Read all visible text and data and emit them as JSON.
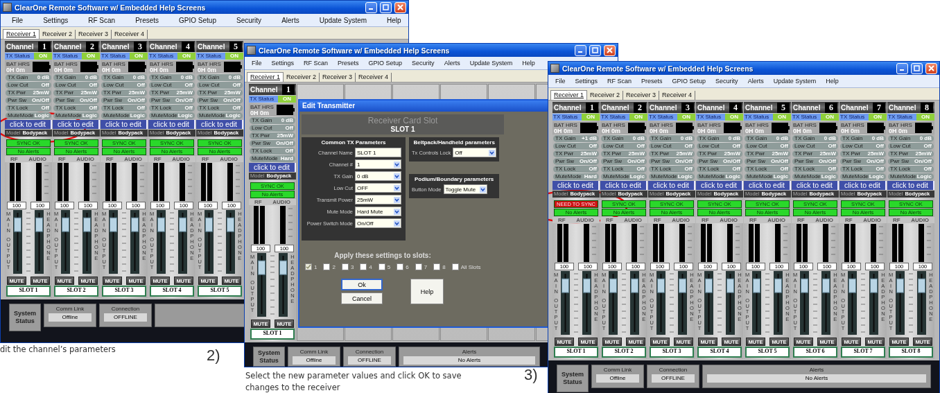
{
  "windows": [
    {
      "title": "ClearOne Remote Software w/ Embedded Help Screens",
      "menu": [
        "File",
        "Settings",
        "RF Scan",
        "Presets",
        "GPIO Setup",
        "Security",
        "Alerts",
        "Update System",
        "Help"
      ],
      "tabs": [
        {
          "label": "Receiver 1",
          "selected": true
        },
        {
          "label": "Receiver 2",
          "selected": false
        },
        {
          "label": "Receiver 3",
          "selected": false
        },
        {
          "label": "Receiver 4",
          "selected": false
        }
      ],
      "channels": [
        {
          "kind": "strip",
          "label": "Channel",
          "number": "1",
          "status": {
            "label": "TX Status",
            "value": "ON"
          },
          "battery": {
            "label": "BAT HRS",
            "value": "0H 0m"
          },
          "params": [
            {
              "label": "TX Gain",
              "value": "0 dB"
            },
            {
              "label": "Low Cut",
              "value": "Off"
            },
            {
              "label": "TX Pwr",
              "value": "25mW"
            },
            {
              "label": "Pwr Sw",
              "value": "On/Off"
            },
            {
              "label": "TX Lock",
              "value": "Off"
            },
            {
              "label": "MuteMode",
              "value": "Logic"
            }
          ],
          "edit": "click to edit",
          "model": {
            "label": "Model",
            "value": "Bodypack"
          },
          "sync": {
            "text": "SYNC OK",
            "ok": true
          },
          "alerts": "No Alerts",
          "meters": [
            "RF",
            "AUDIO"
          ],
          "faders": [
            {
              "value": "100",
              "label": "MAIN OUTPUT",
              "level": 0.88,
              "mute": "MUTE"
            },
            {
              "value": "100",
              "label": "HEADPHONE",
              "level": 0.88,
              "mute": "MUTE"
            }
          ],
          "slot": "SLOT 1"
        },
        {
          "kind": "strip",
          "label": "Channel",
          "number": "2",
          "status": {
            "label": "TX Status",
            "value": "ON"
          },
          "battery": {
            "label": "BAT HRS",
            "value": "0H 0m"
          },
          "params": [
            {
              "label": "TX Gain",
              "value": "0 dB"
            },
            {
              "label": "Low Cut",
              "value": "Off"
            },
            {
              "label": "TX Pwr",
              "value": "25mW"
            },
            {
              "label": "Pwr Sw",
              "value": "On/Off"
            },
            {
              "label": "TX Lock",
              "value": "Off"
            },
            {
              "label": "MuteMode",
              "value": "Logic"
            }
          ],
          "edit": "click to edit",
          "model": {
            "label": "Model",
            "value": "Bodypack"
          },
          "sync": {
            "text": "SYNC OK",
            "ok": true
          },
          "alerts": "No Alerts",
          "meters": [
            "RF",
            "AUDIO"
          ],
          "faders": [
            {
              "value": "100",
              "label": "MAIN OUTPUT",
              "level": 0.88,
              "mute": "MUTE"
            },
            {
              "value": "100",
              "label": "HEADPHONE",
              "level": 0.88,
              "mute": "MUTE"
            }
          ],
          "slot": "SLOT 2"
        },
        {
          "kind": "strip",
          "label": "Channel",
          "number": "3",
          "status": {
            "label": "TX Status",
            "value": "ON"
          },
          "battery": {
            "label": "BAT HRS",
            "value": "0H 0m"
          },
          "params": [
            {
              "label": "TX Gain",
              "value": "0 dB"
            },
            {
              "label": "Low Cut",
              "value": "Off"
            },
            {
              "label": "TX Pwr",
              "value": "25mW"
            },
            {
              "label": "Pwr Sw",
              "value": "On/Off"
            },
            {
              "label": "TX Lock",
              "value": "Off"
            },
            {
              "label": "MuteMode",
              "value": "Logic"
            }
          ],
          "edit": "click to edit",
          "model": {
            "label": "Model",
            "value": "Bodypack"
          },
          "sync": {
            "text": "SYNC OK",
            "ok": true
          },
          "alerts": "No Alerts",
          "meters": [
            "RF",
            "AUDIO"
          ],
          "faders": [
            {
              "value": "100",
              "label": "MAIN OUTPUT",
              "level": 0.88,
              "mute": "MUTE"
            },
            {
              "value": "100",
              "label": "HEADPHONE",
              "level": 0.88,
              "mute": "MUTE"
            }
          ],
          "slot": "SLOT 3"
        },
        {
          "kind": "strip",
          "label": "Channel",
          "number": "4",
          "status": {
            "label": "TX Status",
            "value": "ON"
          },
          "battery": {
            "label": "BAT HRS",
            "value": "0H 0m"
          },
          "params": [
            {
              "label": "TX Gain",
              "value": "0 dB"
            },
            {
              "label": "Low Cut",
              "value": "Off"
            },
            {
              "label": "TX Pwr",
              "value": "25mW"
            },
            {
              "label": "Pwr Sw",
              "value": "On/Off"
            },
            {
              "label": "TX Lock",
              "value": "Off"
            },
            {
              "label": "MuteMode",
              "value": "Logic"
            }
          ],
          "edit": "click to edit",
          "model": {
            "label": "Model",
            "value": "Bodypack"
          },
          "sync": {
            "text": "SYNC OK",
            "ok": true
          },
          "alerts": "No Alerts",
          "meters": [
            "RF",
            "AUDIO"
          ],
          "faders": [
            {
              "value": "100",
              "label": "MAIN OUTPUT",
              "level": 0.88,
              "mute": "MUTE"
            },
            {
              "value": "100",
              "label": "HEADPHONE",
              "level": 0.88,
              "mute": "MUTE"
            }
          ],
          "slot": "SLOT 4"
        },
        {
          "kind": "strip",
          "label": "Channel",
          "number": "5",
          "status": {
            "label": "TX Status",
            "value": "ON"
          },
          "battery": {
            "label": "BAT HRS",
            "value": "0H 0m"
          },
          "params": [
            {
              "label": "TX Gain",
              "value": "0 dB"
            },
            {
              "label": "Low Cut",
              "value": "Off"
            },
            {
              "label": "TX Pwr",
              "value": "25mW"
            },
            {
              "label": "Pwr Sw",
              "value": "On/Off"
            },
            {
              "label": "TX Lock",
              "value": "Off"
            },
            {
              "label": "MuteMode",
              "value": "Logic"
            }
          ],
          "edit": "click to edit",
          "model": {
            "label": "Model",
            "value": "Bodypack"
          },
          "sync": {
            "text": "SYNC OK",
            "ok": true
          },
          "alerts": "No Alerts",
          "meters": [
            "RF",
            "AUDIO"
          ],
          "faders": [
            {
              "value": "100",
              "label": "MAIN OUTPUT",
              "level": 0.88,
              "mute": "MUTE"
            },
            {
              "value": "100",
              "label": "HEADPHONE",
              "level": 0.88,
              "mute": "MUTE"
            }
          ],
          "slot": "SLOT 5"
        }
      ],
      "status": {
        "heading": "System Status",
        "fields": [
          {
            "kind": "narrow",
            "label": "Comm Link",
            "value": "Offline"
          },
          {
            "kind": "narrow",
            "label": "Connection",
            "value": "OFFLINE"
          },
          {
            "kind": "wide"
          }
        ]
      }
    },
    {
      "title": "ClearOne Remote Software w/ Embedded Help Screens",
      "menu": [
        "File",
        "Settings",
        "RF Scan",
        "Presets",
        "GPIO Setup",
        "Security",
        "Alerts",
        "Update System",
        "Help"
      ],
      "tabs": [
        {
          "label": "Receiver 1",
          "selected": true
        },
        {
          "label": "Receiver 2",
          "selected": false
        },
        {
          "label": "Receiver 3",
          "selected": false
        },
        {
          "label": "Receiver 4",
          "selected": false
        }
      ],
      "channels": [
        {
          "kind": "strip",
          "label": "Channel",
          "number": "1",
          "status": {
            "label": "TX Status",
            "value": "ON"
          },
          "battery": {
            "label": "BAT HRS",
            "value": "0H 0m"
          },
          "params": [
            {
              "label": "TX Gain",
              "value": "0 dB"
            },
            {
              "label": "Low Cut",
              "value": "Off"
            },
            {
              "label": "TX Pwr",
              "value": "25mW"
            },
            {
              "label": "Pwr Sw",
              "value": "On/Off"
            },
            {
              "label": "TX Lock",
              "value": "Off"
            },
            {
              "label": "MuteMode",
              "value": "Hard"
            }
          ],
          "edit": "click to edit",
          "model": {
            "label": "Model",
            "value": "Bodypack"
          },
          "sync": {
            "text": "SYNC OK",
            "ok": true
          },
          "alerts": "No Alerts",
          "meters": [
            "RF",
            "AUDIO"
          ],
          "faders": [
            {
              "value": "100",
              "label": "MAIN OUTPUT",
              "level": 0.88,
              "mute": "MUTE"
            },
            {
              "value": "100",
              "label": "HEADPHONE",
              "level": 0.88,
              "mute": "MUTE"
            }
          ],
          "slot": "SLOT 1"
        },
        {
          "kind": "empty"
        },
        {
          "kind": "empty"
        },
        {
          "kind": "empty"
        },
        {
          "kind": "empty"
        },
        {
          "kind": "empty"
        },
        {
          "kind": "empty"
        }
      ],
      "dialog": {
        "title": "Edit Transmitter",
        "header": "Receiver Card Slot",
        "slot": "SLOT 1",
        "common": {
          "title": "Common TX Parameters",
          "fields": [
            {
              "label": "Channel Name",
              "value": "SLOT 1",
              "kind": "text"
            },
            {
              "label": "Channel #",
              "value": "1",
              "kind": "select"
            },
            {
              "label": "TX Gain",
              "value": "0 dB",
              "kind": "select"
            },
            {
              "label": "Low Cut",
              "value": "OFF",
              "kind": "select"
            },
            {
              "label": "Transmit Power",
              "value": "25mW",
              "kind": "select"
            },
            {
              "label": "Mute Mode",
              "value": "Hard Mute",
              "kind": "select"
            },
            {
              "label": "Power Switch Mode",
              "value": "On/Off",
              "kind": "select"
            }
          ]
        },
        "bodypack": {
          "title": "Beltpack/Handheld parameters",
          "fields": [
            {
              "label": "Tx Controls Lock",
              "value": "Off",
              "kind": "select"
            }
          ]
        },
        "podium": {
          "title": "Podium/Boundary parameters",
          "fields": [
            {
              "label": "Button Mode",
              "value": "Toggle Mute",
              "kind": "select"
            }
          ]
        },
        "apply_label": "Apply these settings to slots:",
        "slots": [
          {
            "label": "1",
            "checked": true
          },
          {
            "label": "2",
            "checked": false
          },
          {
            "label": "3",
            "checked": false
          },
          {
            "label": "4",
            "checked": false
          },
          {
            "label": "5",
            "checked": false
          },
          {
            "label": "6",
            "checked": false
          },
          {
            "label": "7",
            "checked": false
          },
          {
            "label": "8",
            "checked": false
          },
          {
            "label": "All Slots",
            "checked": false
          }
        ],
        "buttons": [
          {
            "label": "Ok",
            "default": true
          },
          {
            "label": "Cancel",
            "default": false
          }
        ],
        "help_button": "Help"
      },
      "status": {
        "heading": "System Status",
        "fields": [
          {
            "kind": "narrow",
            "label": "Comm Link",
            "value": "Offline"
          },
          {
            "kind": "narrow",
            "label": "Connection",
            "value": "OFFLINE"
          },
          {
            "kind": "wide",
            "label": "Alerts",
            "value": "No Alerts"
          }
        ]
      }
    },
    {
      "title": "ClearOne Remote Software w/ Embedded Help Screens",
      "menu": [
        "File",
        "Settings",
        "RF Scan",
        "Presets",
        "GPIO Setup",
        "Security",
        "Alerts",
        "Update System",
        "Help"
      ],
      "tabs": [
        {
          "label": "Receiver 1",
          "selected": true
        },
        {
          "label": "Receiver 2",
          "selected": false
        },
        {
          "label": "Receiver 3",
          "selected": false
        },
        {
          "label": "Receiver 4",
          "selected": false
        }
      ],
      "channels": [
        {
          "kind": "strip",
          "label": "Channel",
          "number": "1",
          "status": {
            "label": "TX Status",
            "value": "ON"
          },
          "battery": {
            "label": "BAT HRS",
            "value": "0H 0m"
          },
          "params": [
            {
              "label": "TX Gain",
              "value": "+1 dB"
            },
            {
              "label": "Low Cut",
              "value": "Off"
            },
            {
              "label": "TX Pwr",
              "value": "25mW"
            },
            {
              "label": "Pwr Sw",
              "value": "On/Off"
            },
            {
              "label": "TX Lock",
              "value": "Off"
            },
            {
              "label": "MuteMode",
              "value": "Hard"
            }
          ],
          "edit": "click to edit",
          "model": {
            "label": "Model",
            "value": "Bodypack"
          },
          "sync": {
            "text": "NEED TO SYNC",
            "ok": false
          },
          "alerts": "No Alerts",
          "meters": [
            "RF",
            "AUDIO"
          ],
          "faders": [
            {
              "value": "100",
              "label": "MAIN OUTPUT",
              "level": 0.88,
              "mute": "MUTE"
            },
            {
              "value": "100",
              "label": "HEADPHONE",
              "level": 0.88,
              "mute": "MUTE"
            }
          ],
          "slot": "SLOT 1"
        },
        {
          "kind": "strip",
          "label": "Channel",
          "number": "2",
          "status": {
            "label": "TX Status",
            "value": "ON"
          },
          "battery": {
            "label": "BAT HRS",
            "value": "0H 0m"
          },
          "params": [
            {
              "label": "TX Gain",
              "value": "0 dB"
            },
            {
              "label": "Low Cut",
              "value": "Off"
            },
            {
              "label": "TX Pwr",
              "value": "25mW"
            },
            {
              "label": "Pwr Sw",
              "value": "On/Off"
            },
            {
              "label": "TX Lock",
              "value": "Off"
            },
            {
              "label": "MuteMode",
              "value": "Logic"
            }
          ],
          "edit": "click to edit",
          "model": {
            "label": "Model",
            "value": "Bodypack"
          },
          "sync": {
            "text": "SYNC OK",
            "ok": true
          },
          "alerts": "No Alerts",
          "meters": [
            "RF",
            "AUDIO"
          ],
          "faders": [
            {
              "value": "100",
              "label": "MAIN OUTPUT",
              "level": 0.88,
              "mute": "MUTE"
            },
            {
              "value": "100",
              "label": "HEADPHONE",
              "level": 0.88,
              "mute": "MUTE"
            }
          ],
          "slot": "SLOT 2"
        },
        {
          "kind": "strip",
          "label": "Channel",
          "number": "3",
          "status": {
            "label": "TX Status",
            "value": "ON"
          },
          "battery": {
            "label": "BAT HRS",
            "value": "0H 0m"
          },
          "params": [
            {
              "label": "TX Gain",
              "value": "0 dB"
            },
            {
              "label": "Low Cut",
              "value": "Off"
            },
            {
              "label": "TX Pwr",
              "value": "25mW"
            },
            {
              "label": "Pwr Sw",
              "value": "On/Off"
            },
            {
              "label": "TX Lock",
              "value": "Off"
            },
            {
              "label": "MuteMode",
              "value": "Logic"
            }
          ],
          "edit": "click to edit",
          "model": {
            "label": "Model",
            "value": "Bodypack"
          },
          "sync": {
            "text": "SYNC OK",
            "ok": true
          },
          "alerts": "No Alerts",
          "meters": [
            "RF",
            "AUDIO"
          ],
          "faders": [
            {
              "value": "100",
              "label": "MAIN OUTPUT",
              "level": 0.88,
              "mute": "MUTE"
            },
            {
              "value": "100",
              "label": "HEADPHONE",
              "level": 0.88,
              "mute": "MUTE"
            }
          ],
          "slot": "SLOT 3"
        },
        {
          "kind": "strip",
          "label": "Channel",
          "number": "4",
          "status": {
            "label": "TX Status",
            "value": "ON"
          },
          "battery": {
            "label": "BAT HRS",
            "value": "0H 0m"
          },
          "params": [
            {
              "label": "TX Gain",
              "value": "0 dB"
            },
            {
              "label": "Low Cut",
              "value": "Off"
            },
            {
              "label": "TX Pwr",
              "value": "25mW"
            },
            {
              "label": "Pwr Sw",
              "value": "On/Off"
            },
            {
              "label": "TX Lock",
              "value": "Off"
            },
            {
              "label": "MuteMode",
              "value": "Logic"
            }
          ],
          "edit": "click to edit",
          "model": {
            "label": "Model",
            "value": "Bodypack"
          },
          "sync": {
            "text": "SYNC OK",
            "ok": true
          },
          "alerts": "No Alerts",
          "meters": [
            "RF",
            "AUDIO"
          ],
          "faders": [
            {
              "value": "100",
              "label": "MAIN OUTPUT",
              "level": 0.88,
              "mute": "MUTE"
            },
            {
              "value": "100",
              "label": "HEADPHONE",
              "level": 0.88,
              "mute": "MUTE"
            }
          ],
          "slot": "SLOT 4"
        },
        {
          "kind": "strip",
          "label": "Channel",
          "number": "5",
          "status": {
            "label": "TX Status",
            "value": "ON"
          },
          "battery": {
            "label": "BAT HRS",
            "value": "0H 0m"
          },
          "params": [
            {
              "label": "TX Gain",
              "value": "0 dB"
            },
            {
              "label": "Low Cut",
              "value": "Off"
            },
            {
              "label": "TX Pwr",
              "value": "25mW"
            },
            {
              "label": "Pwr Sw",
              "value": "On/Off"
            },
            {
              "label": "TX Lock",
              "value": "Off"
            },
            {
              "label": "MuteMode",
              "value": "Logic"
            }
          ],
          "edit": "click to edit",
          "model": {
            "label": "Model",
            "value": "Bodypack"
          },
          "sync": {
            "text": "SYNC OK",
            "ok": true
          },
          "alerts": "No Alerts",
          "meters": [
            "RF",
            "AUDIO"
          ],
          "faders": [
            {
              "value": "100",
              "label": "MAIN OUTPUT",
              "level": 0.88,
              "mute": "MUTE"
            },
            {
              "value": "100",
              "label": "HEADPHONE",
              "level": 0.88,
              "mute": "MUTE"
            }
          ],
          "slot": "SLOT 5"
        },
        {
          "kind": "strip",
          "label": "Channel",
          "number": "6",
          "status": {
            "label": "TX Status",
            "value": "ON"
          },
          "battery": {
            "label": "BAT HRS",
            "value": "0H 0m"
          },
          "params": [
            {
              "label": "TX Gain",
              "value": "0 dB"
            },
            {
              "label": "Low Cut",
              "value": "Off"
            },
            {
              "label": "TX Pwr",
              "value": "25mW"
            },
            {
              "label": "Pwr Sw",
              "value": "On/Off"
            },
            {
              "label": "TX Lock",
              "value": "Off"
            },
            {
              "label": "MuteMode",
              "value": "Logic"
            }
          ],
          "edit": "click to edit",
          "model": {
            "label": "Model",
            "value": "Bodypack"
          },
          "sync": {
            "text": "SYNC OK",
            "ok": true
          },
          "alerts": "No Alerts",
          "meters": [
            "RF",
            "AUDIO"
          ],
          "faders": [
            {
              "value": "100",
              "label": "MAIN OUTPUT",
              "level": 0.88,
              "mute": "MUTE"
            },
            {
              "value": "100",
              "label": "HEADPHONE",
              "level": 0.88,
              "mute": "MUTE"
            }
          ],
          "slot": "SLOT 6"
        },
        {
          "kind": "strip",
          "label": "Channel",
          "number": "7",
          "status": {
            "label": "TX Status",
            "value": "ON"
          },
          "battery": {
            "label": "BAT HRS",
            "value": "0H 0m"
          },
          "params": [
            {
              "label": "TX Gain",
              "value": "0 dB"
            },
            {
              "label": "Low Cut",
              "value": "Off"
            },
            {
              "label": "TX Pwr",
              "value": "25mW"
            },
            {
              "label": "Pwr Sw",
              "value": "On/Off"
            },
            {
              "label": "TX Lock",
              "value": "Off"
            },
            {
              "label": "MuteMode",
              "value": "Logic"
            }
          ],
          "edit": "click to edit",
          "model": {
            "label": "Model",
            "value": "Bodypack"
          },
          "sync": {
            "text": "SYNC OK",
            "ok": true
          },
          "alerts": "No Alerts",
          "meters": [
            "RF",
            "AUDIO"
          ],
          "faders": [
            {
              "value": "100",
              "label": "MAIN OUTPUT",
              "level": 0.88,
              "mute": "MUTE"
            },
            {
              "value": "100",
              "label": "HEADPHONE",
              "level": 0.88,
              "mute": "MUTE"
            }
          ],
          "slot": "SLOT 7"
        },
        {
          "kind": "strip",
          "label": "Channel",
          "number": "8",
          "status": {
            "label": "TX Status",
            "value": "ON"
          },
          "battery": {
            "label": "BAT HRS",
            "value": "0H 0m"
          },
          "params": [
            {
              "label": "TX Gain",
              "value": "0 dB"
            },
            {
              "label": "Low Cut",
              "value": "Off"
            },
            {
              "label": "TX Pwr",
              "value": "25mW"
            },
            {
              "label": "Pwr Sw",
              "value": "On/Off"
            },
            {
              "label": "TX Lock",
              "value": "Off"
            },
            {
              "label": "MuteMode",
              "value": "Logic"
            }
          ],
          "edit": "click to edit",
          "model": {
            "label": "Model",
            "value": "Bodypack"
          },
          "sync": {
            "text": "SYNC OK",
            "ok": true
          },
          "alerts": "No Alerts",
          "meters": [
            "RF",
            "AUDIO"
          ],
          "faders": [
            {
              "value": "100",
              "label": "MAIN OUTPUT",
              "level": 0.88,
              "mute": "MUTE"
            },
            {
              "value": "100",
              "label": "HEADPHONE",
              "level": 0.88,
              "mute": "MUTE"
            }
          ],
          "slot": "SLOT 8"
        }
      ],
      "status": {
        "heading": "System Status",
        "fields": [
          {
            "kind": "narrow",
            "label": "Comm Link",
            "value": "Offline"
          },
          {
            "kind": "narrow",
            "label": "Connection",
            "value": "OFFLINE"
          },
          {
            "kind": "wide",
            "label": "Alerts",
            "value": "No Alerts"
          }
        ]
      }
    }
  ],
  "captions": [
    {
      "text_lines": [
        "dit the channel’s parameters"
      ]
    },
    {
      "number": "2)",
      "text_lines": [
        "Select the new parameter values and click OK to save",
        "changes to the receiver"
      ]
    },
    {
      "number": "3)"
    }
  ]
}
